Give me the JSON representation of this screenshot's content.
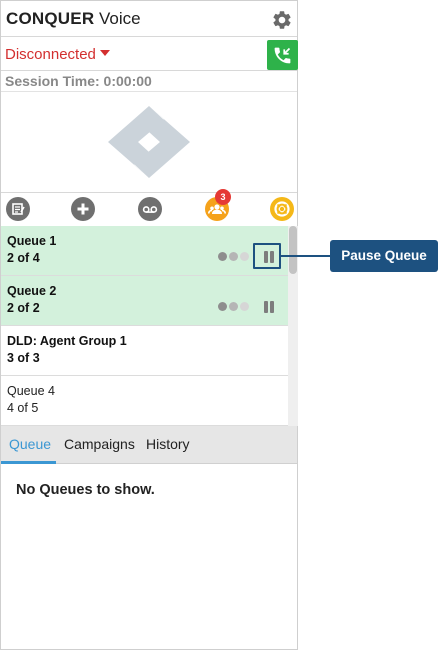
{
  "header": {
    "brand_bold": "CONQUER",
    "brand_light": "Voice",
    "settings_icon": "gear-icon"
  },
  "status": {
    "label": "Disconnected",
    "color": "#d32f2f",
    "call_icon": "phone-incoming-icon",
    "call_button_color": "#2eb24a"
  },
  "session": {
    "text": "Session Time: 0:00:00"
  },
  "toolbar": {
    "icons": [
      "notes-icon",
      "add-icon",
      "voicemail-icon",
      "agents-icon",
      "help-icon"
    ],
    "agents_badge": "3"
  },
  "queues": [
    {
      "name": "Queue 1",
      "count": "2 of 4",
      "active": true
    },
    {
      "name": "Queue 2",
      "count": "2 of 2",
      "active": true
    },
    {
      "name": "DLD: Agent Group 1",
      "count": "3 of 3",
      "active": false
    },
    {
      "name": "Queue 4",
      "count": "4 of 5",
      "active": false
    }
  ],
  "callout": {
    "label": "Pause Queue",
    "color": "#1d5180"
  },
  "tabs": [
    {
      "label": "Queue",
      "active": true
    },
    {
      "label": "Campaigns",
      "active": false
    },
    {
      "label": "History",
      "active": false
    }
  ],
  "empty_message": "No Queues to show.",
  "colors": {
    "accent": "#3b97d3",
    "active_row": "#d3f1dc",
    "toolbar_icon": "#6f6f6f",
    "agents_icon": "#f5a21b",
    "help_icon": "#f5b818"
  }
}
